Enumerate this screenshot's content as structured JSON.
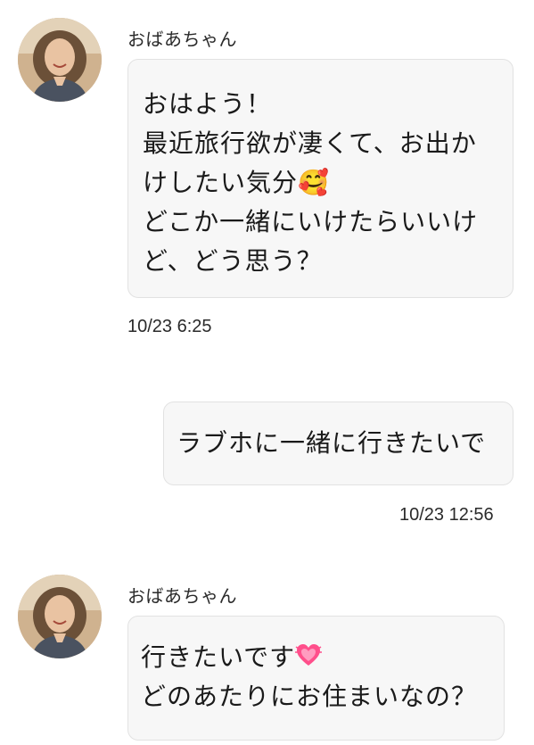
{
  "messages": [
    {
      "sender": "おばあちゃん",
      "lines": [
        "おはよう！",
        "最近旅行欲が凄くて、お出か",
        "けしたい気分",
        "どこか一緒にいけたらいいけ",
        "ど、どう思う？"
      ],
      "emoji": "🥰",
      "timestamp": "10/23 6:25"
    },
    {
      "sender": "",
      "lines": [
        "ラブホに一緒に行きたいで"
      ],
      "timestamp": "10/23 12:56"
    },
    {
      "sender": "おばあちゃん",
      "lines": [
        "行きたいです",
        "どのあたりにお住まいなの？"
      ],
      "emoji": "heart-icon",
      "timestamp": ""
    }
  ],
  "colors": {
    "bubble_bg": "#f7f7f7",
    "bubble_border": "#e2e2e2",
    "heart": "#ff4f8b"
  }
}
